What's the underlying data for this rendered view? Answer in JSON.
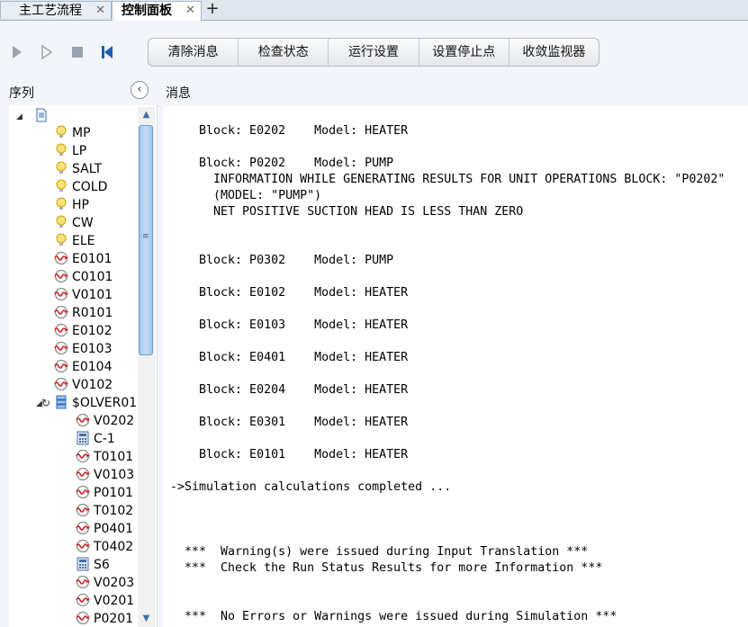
{
  "tabs": [
    {
      "label": "主工艺流程"
    },
    {
      "label": "控制面板"
    }
  ],
  "toolbar": {
    "play_icon": "play-icon",
    "step_icon": "step-icon",
    "stop_icon": "stop-icon",
    "reset_icon": "rewind-icon",
    "buttons": [
      {
        "label": "清除消息"
      },
      {
        "label": "检查状态"
      },
      {
        "label": "运行设置"
      },
      {
        "label": "设置停止点"
      },
      {
        "label": "收敛监视器"
      }
    ]
  },
  "sidebar": {
    "title": "序列",
    "items": [
      {
        "label": "",
        "icon": "document-icon"
      },
      {
        "label": "MP",
        "icon": "bulb-icon"
      },
      {
        "label": "LP",
        "icon": "bulb-icon"
      },
      {
        "label": "SALT",
        "icon": "bulb-icon"
      },
      {
        "label": "COLD",
        "icon": "bulb-icon"
      },
      {
        "label": "HP",
        "icon": "bulb-icon"
      },
      {
        "label": "CW",
        "icon": "bulb-icon"
      },
      {
        "label": "ELE",
        "icon": "bulb-icon"
      },
      {
        "label": "E0101",
        "icon": "block-icon"
      },
      {
        "label": "C0101",
        "icon": "block-icon"
      },
      {
        "label": "V0101",
        "icon": "block-icon"
      },
      {
        "label": "R0101",
        "icon": "block-icon"
      },
      {
        "label": "E0102",
        "icon": "block-icon"
      },
      {
        "label": "E0103",
        "icon": "block-icon"
      },
      {
        "label": "E0104",
        "icon": "block-icon"
      },
      {
        "label": "V0102",
        "icon": "block-icon"
      },
      {
        "label": "$OLVER01",
        "icon": "solver-icon"
      },
      {
        "label": "V0202",
        "icon": "block-icon"
      },
      {
        "label": "C-1",
        "icon": "calculator-icon"
      },
      {
        "label": "T0101",
        "icon": "block-icon"
      },
      {
        "label": "V0103",
        "icon": "block-icon"
      },
      {
        "label": "P0101",
        "icon": "block-icon"
      },
      {
        "label": "T0102",
        "icon": "block-icon"
      },
      {
        "label": "P0401",
        "icon": "block-icon"
      },
      {
        "label": "T0402",
        "icon": "block-icon"
      },
      {
        "label": "S6",
        "icon": "calculator-icon"
      },
      {
        "label": "V0203",
        "icon": "block-icon"
      },
      {
        "label": "V0201",
        "icon": "block-icon"
      },
      {
        "label": "P0201",
        "icon": "block-icon"
      }
    ]
  },
  "messages": {
    "title": "消息",
    "lines": [
      "    Block: E0202    Model: HEATER",
      "    Block: P0202    Model: PUMP",
      "      INFORMATION WHILE GENERATING RESULTS FOR UNIT OPERATIONS BLOCK: \"P0202\"",
      "      (MODEL: \"PUMP\")",
      "      NET POSITIVE SUCTION HEAD IS LESS THAN ZERO",
      "    Block: P0302    Model: PUMP",
      "    Block: E0102    Model: HEATER",
      "    Block: E0103    Model: HEATER",
      "    Block: E0401    Model: HEATER",
      "    Block: E0204    Model: HEATER",
      "    Block: E0301    Model: HEATER",
      "    Block: E0101    Model: HEATER",
      "->Simulation calculations completed ...",
      "  ***  Warning(s) were issued during Input Translation ***",
      "  ***  Check the Run Status Results for more Information ***",
      "  ***  No Errors or Warnings were issued during Simulation ***"
    ]
  }
}
